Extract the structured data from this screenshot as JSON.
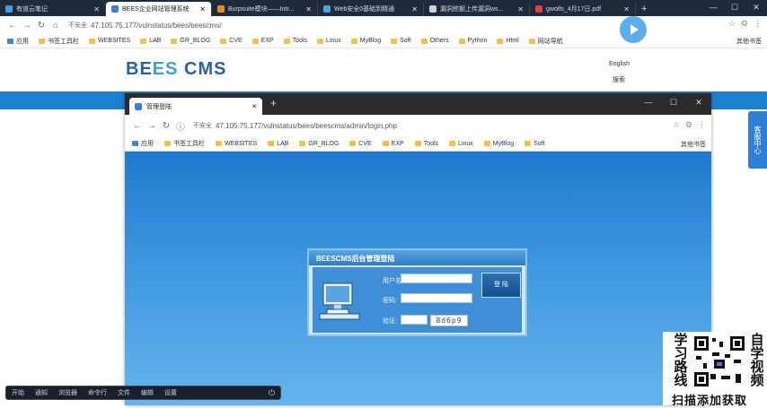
{
  "outer_tabs": [
    {
      "label": "有道云笔记",
      "color": "#3da0e8",
      "active": false
    },
    {
      "label": "BEES企业网站管理系统",
      "color": "#3d7fd6",
      "active": true
    },
    {
      "label": "Burpsuite模块——Intr...",
      "color": "#e98a2b",
      "active": false
    },
    {
      "label": "Web安全0基础到精通",
      "color": "#4aa6ea",
      "active": false
    },
    {
      "label": "漏洞挖掘上传漏洞ws...",
      "color": "#d1d1d1",
      "active": false
    },
    {
      "label": "gwolfs_4月17日.pdf",
      "color": "#d44",
      "active": false
    }
  ],
  "outer_address": {
    "insecure": "不安全",
    "url": "47.105.75.177/vulnstatus/bees/beescms/"
  },
  "bookmarks": [
    "应用",
    "书签工具栏",
    "WEBSITES",
    "LAB",
    "GR_BLOG",
    "CVE",
    "EXP",
    "Tools",
    "Linux",
    "MyBlog",
    "Soft",
    "Others",
    "Python",
    "Html",
    "网站导航"
  ],
  "bookmarks_right": "其他书签",
  "bees": {
    "logo_a": "BE",
    "logo_c": "ES",
    "logo_b": " CMS",
    "lang": "English",
    "search": "搜索"
  },
  "side_tab": "客服中心",
  "inner_tab": {
    "label": "管理登陆"
  },
  "inner_address": {
    "insecure": "不安全",
    "url": "47.105.75.177/vulnstatus/bees/beescms/admin/login.php"
  },
  "inner_bookmarks": [
    "应用",
    "书签工具栏",
    "WEBSITES",
    "LAB",
    "GR_BLOG",
    "CVE",
    "EXP",
    "Tools",
    "Linux",
    "MyBlog",
    "Soft"
  ],
  "inner_bookmarks_right": "其他书签",
  "login": {
    "title": "BEESCMS后台管理登陆",
    "user_label": "用户名:",
    "pass_label": "密码:",
    "code_label": "验证:",
    "captcha": "8d6p9",
    "button": "登 陆"
  },
  "taskbar": [
    "开始",
    "通知",
    "浏览器",
    "命令行",
    "文件",
    "编辑",
    "设置"
  ],
  "promo": {
    "left": "学习路线",
    "right": "自学视频",
    "bottom": "扫描添加获取"
  }
}
